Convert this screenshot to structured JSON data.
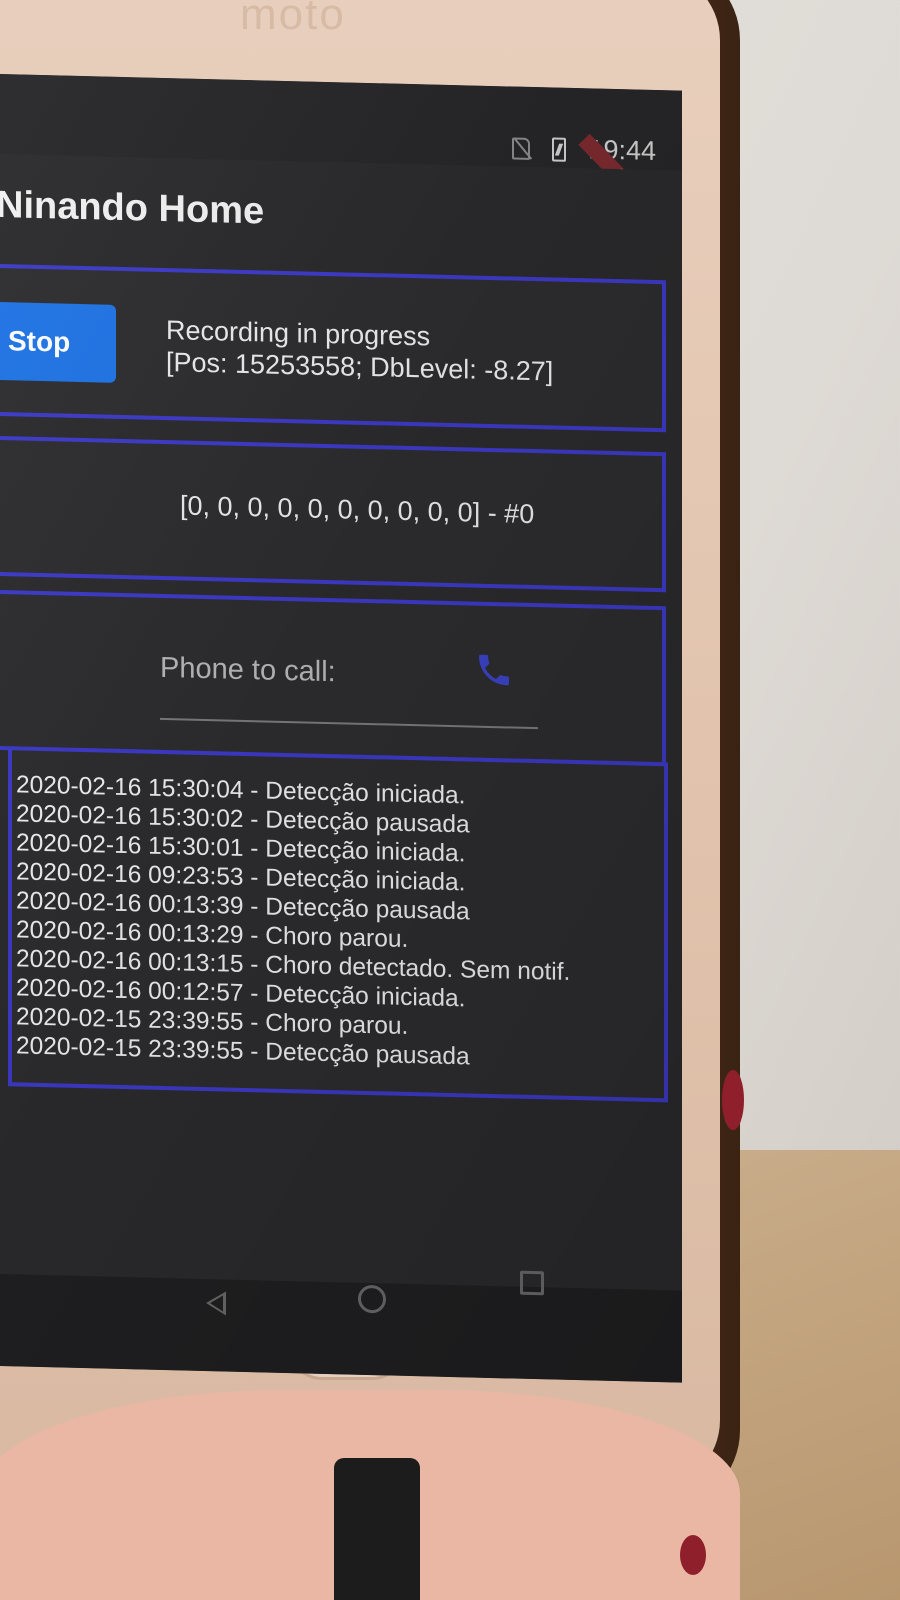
{
  "status_bar": {
    "time": "19:44",
    "debug_banner": "DEBUG",
    "icons": [
      "no-sim-icon",
      "battery-charging-icon"
    ]
  },
  "device": {
    "brand": "moto"
  },
  "app_bar": {
    "title": "Ninando Home"
  },
  "recorder": {
    "stop_label": "Stop",
    "status_line1": "Recording in progress",
    "status_line2": "[Pos: 15253558;  DbLevel: -8.27]"
  },
  "levels": {
    "text": "[0, 0, 0, 0, 0, 0, 0, 0, 0, 0] - #0"
  },
  "phone_input": {
    "placeholder": "Phone to call:",
    "icon": "phone-icon"
  },
  "log": {
    "entries": [
      "2020-02-16 15:30:04 - Detecção iniciada.",
      "2020-02-16 15:30:02 - Detecção pausada",
      "2020-02-16 15:30:01 - Detecção iniciada.",
      "2020-02-16 09:23:53 - Detecção iniciada.",
      "2020-02-16 00:13:39 - Detecção pausada",
      "2020-02-16 00:13:29 - Choro parou.",
      "2020-02-16 00:13:15 - Choro detectado. Sem notif.",
      "2020-02-16 00:12:57 - Detecção iniciada.",
      "2020-02-15 23:39:55 - Choro parou.",
      "2020-02-15 23:39:55 - Detecção pausada"
    ]
  },
  "nav_bar": {
    "icons": [
      "back-icon",
      "home-icon",
      "recent-apps-icon"
    ]
  },
  "colors": {
    "accent_blue": "#1f74e6",
    "panel_border": "#3d3ac8",
    "screen_bg": "#2b2b2e",
    "phone_body": "#e2c4ae"
  }
}
